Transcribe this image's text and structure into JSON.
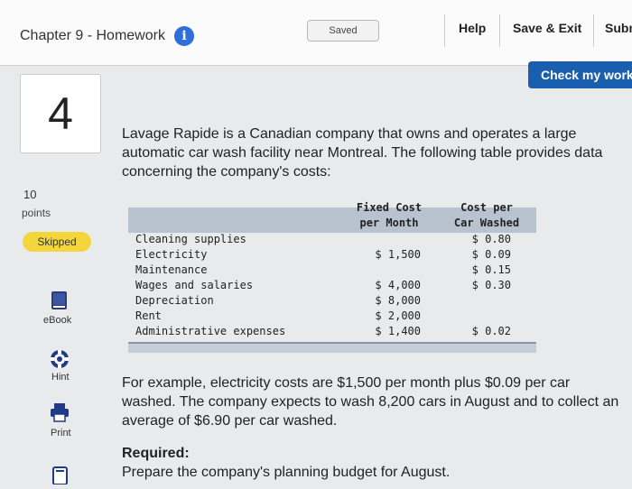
{
  "header": {
    "title": "Chapter 9 - Homework",
    "saved_label": "Saved",
    "help_label": "Help",
    "save_exit_label": "Save & Exit",
    "submit_label": "Subm"
  },
  "check_button_label": "Check my work",
  "question": {
    "number": "4",
    "points_value": "10",
    "points_label": "points",
    "status_badge": "Skipped"
  },
  "tools": {
    "ebook_label": "eBook",
    "hint_label": "Hint",
    "print_label": "Print"
  },
  "intro_text": "Lavage Rapide is a Canadian company that owns and operates a large automatic car wash facility near Montreal. The following table provides data concerning the company's costs:",
  "cost_table": {
    "header_fixed_line1": "Fixed Cost",
    "header_fixed_line2": "per Month",
    "header_car_line1": "Cost per",
    "header_car_line2": "Car Washed",
    "rows": [
      {
        "item": "Cleaning supplies",
        "fixed": "",
        "per_car": "$ 0.80"
      },
      {
        "item": "Electricity",
        "fixed": "$ 1,500",
        "per_car": "$ 0.09"
      },
      {
        "item": "Maintenance",
        "fixed": "",
        "per_car": "$ 0.15"
      },
      {
        "item": "Wages and salaries",
        "fixed": "$ 4,000",
        "per_car": "$ 0.30"
      },
      {
        "item": "Depreciation",
        "fixed": "$ 8,000",
        "per_car": ""
      },
      {
        "item": "Rent",
        "fixed": "$ 2,000",
        "per_car": ""
      },
      {
        "item": "Administrative expenses",
        "fixed": "$ 1,400",
        "per_car": "$ 0.02"
      }
    ]
  },
  "example_text": "For example, electricity costs are $1,500 per month plus $0.09 per car washed. The company expects to wash 8,200 cars in August and to collect an average of $6.90 per car washed.",
  "required_label": "Required:",
  "required_text": "Prepare the company's planning budget for August.",
  "colors": {
    "accent_blue": "#1a5faf",
    "skipped_yellow": "#f3d63b",
    "table_header": "#b9c3d0"
  }
}
